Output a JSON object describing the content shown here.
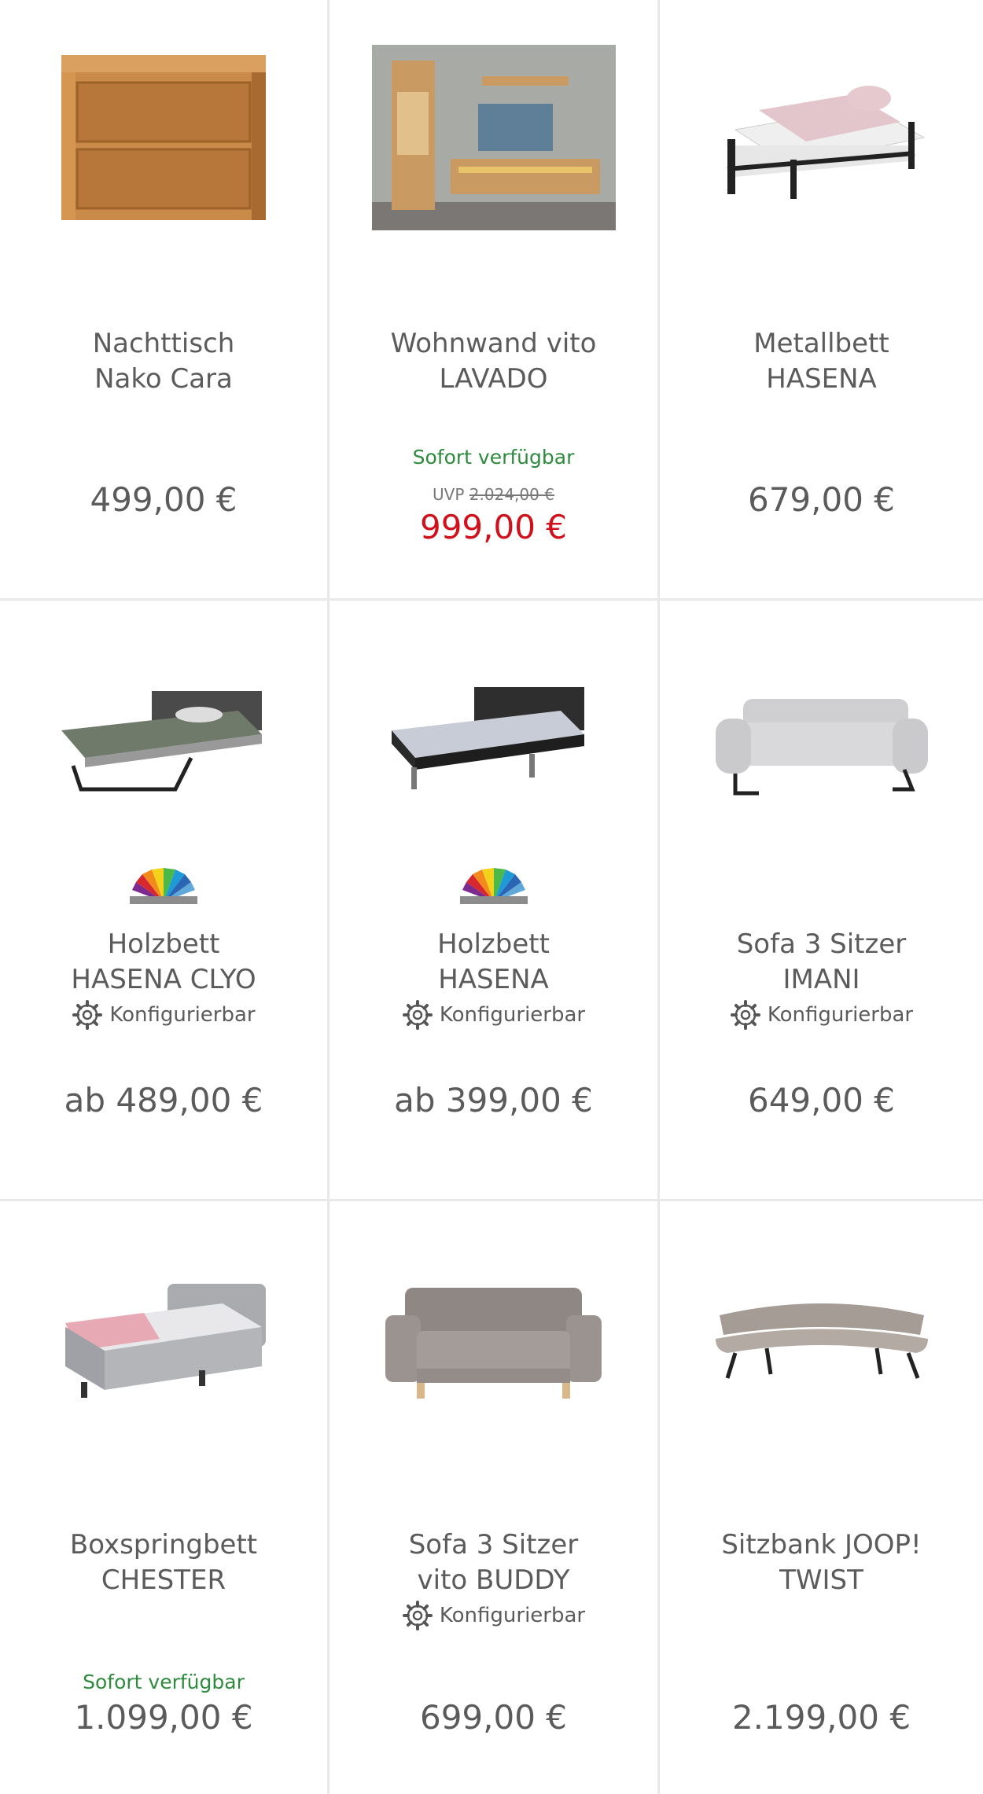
{
  "products": [
    {
      "title_line1": "Nachttisch",
      "title_line2": "Nako Cara",
      "price": "499,00 €"
    },
    {
      "title_line1": "Wohnwand vito",
      "title_line2": "LAVADO",
      "availability": "Sofort verfügbar",
      "uvp_label": "UVP",
      "uvp_price": "2.024,00 €",
      "price": "999,00 €"
    },
    {
      "title_line1": "Metallbett",
      "title_line2": "HASENA",
      "price": "679,00 €"
    },
    {
      "title_line1": "Holzbett",
      "title_line2": "HASENA CLYO",
      "config_label": "Konfigurierbar",
      "price": "ab 489,00 €"
    },
    {
      "title_line1": "Holzbett",
      "title_line2": "HASENA",
      "config_label": "Konfigurierbar",
      "price": "ab 399,00 €"
    },
    {
      "title_line1": "Sofa 3 Sitzer",
      "title_line2": "IMANI",
      "config_label": "Konfigurierbar",
      "price": "649,00 €"
    },
    {
      "title_line1": "Boxspringbett",
      "title_line2": "CHESTER",
      "availability": "Sofort verfügbar",
      "price": "1.099,00 €"
    },
    {
      "title_line1": "Sofa 3 Sitzer",
      "title_line2": "vito BUDDY",
      "config_label": "Konfigurierbar",
      "price": "699,00 €"
    },
    {
      "title_line1": "Sitzbank JOOP!",
      "title_line2": "TWIST",
      "price": "2.199,00 €"
    }
  ],
  "colors": {
    "price": "#5b5b5b",
    "sale_price": "#d0101b",
    "availability": "#2e8b3e",
    "divider": "#e8e8e8"
  }
}
